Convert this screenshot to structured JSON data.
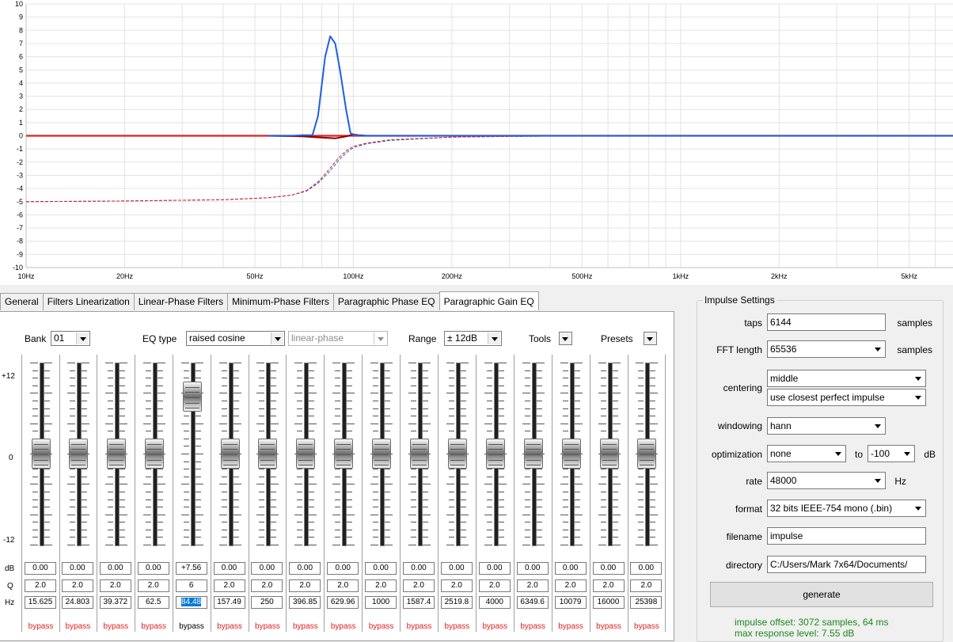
{
  "chart_data": {
    "type": "line",
    "xscale": "log",
    "xlim": [
      10,
      6800
    ],
    "ylim": [
      -10,
      10
    ],
    "y_ticks": [
      "10",
      "9",
      "8",
      "7",
      "6",
      "5",
      "4",
      "3",
      "2",
      "1",
      "0",
      "-1",
      "-2",
      "-3",
      "-4",
      "-5",
      "-6",
      "-7",
      "-8",
      "-9",
      "-10"
    ],
    "x_ticks": [
      {
        "label": "10Hz",
        "value": 10
      },
      {
        "label": "20Hz",
        "value": 20
      },
      {
        "label": "50Hz",
        "value": 50
      },
      {
        "label": "100Hz",
        "value": 100
      },
      {
        "label": "200Hz",
        "value": 200
      },
      {
        "label": "500Hz",
        "value": 500
      },
      {
        "label": "1kHz",
        "value": 1000
      },
      {
        "label": "2kHz",
        "value": 2000
      },
      {
        "label": "5kHz",
        "value": 5000
      }
    ],
    "grid": true,
    "series": [
      {
        "color": "#1f5fe0",
        "style": "solid",
        "x": [
          55,
          66,
          70,
          75,
          78,
          80,
          82,
          85,
          88,
          91,
          95,
          98,
          100,
          103,
          106,
          110,
          150,
          6800
        ],
        "y": [
          0,
          0,
          0.05,
          0.05,
          1.5,
          3.8,
          6.0,
          7.55,
          7.0,
          5.0,
          2.0,
          0.2,
          0.1,
          0.05,
          0,
          0,
          0,
          0
        ]
      },
      {
        "color": "#8b0000",
        "style": "solid",
        "x": [
          55,
          70,
          76,
          82,
          88,
          95,
          100,
          104,
          110,
          150,
          600
        ],
        "y": [
          0,
          -0.05,
          -0.1,
          -0.15,
          -0.2,
          -0.05,
          0.1,
          0.05,
          0,
          0,
          0
        ]
      },
      {
        "color": "#e02020",
        "style": "solid",
        "x": [
          10,
          6800
        ],
        "y": [
          0,
          0
        ]
      },
      {
        "color": "#1f5fe0",
        "style": "dashed",
        "x": [
          10,
          20,
          40,
          55,
          65,
          72,
          78,
          84,
          90,
          95,
          100,
          110,
          130,
          200,
          300,
          600
        ],
        "y": [
          -5,
          -4.95,
          -4.85,
          -4.7,
          -4.5,
          -4.2,
          -3.6,
          -2.8,
          -1.9,
          -1.3,
          -0.9,
          -0.6,
          -0.35,
          -0.1,
          -0.05,
          0
        ]
      },
      {
        "color": "#e02020",
        "style": "dashed",
        "x": [
          10,
          20,
          40,
          55,
          65,
          72,
          78,
          84,
          90,
          95,
          100,
          110,
          130,
          200,
          300,
          600
        ],
        "y": [
          -5,
          -4.95,
          -4.85,
          -4.7,
          -4.5,
          -4.15,
          -3.5,
          -2.6,
          -1.7,
          -1.15,
          -0.8,
          -0.55,
          -0.3,
          -0.1,
          -0.05,
          0
        ]
      }
    ]
  },
  "tabs": [
    {
      "label": "General",
      "active": false
    },
    {
      "label": "Filters Linearization",
      "active": false
    },
    {
      "label": "Linear-Phase Filters",
      "active": false
    },
    {
      "label": "Minimum-Phase Filters",
      "active": false
    },
    {
      "label": "Paragraphic Phase EQ",
      "active": false
    },
    {
      "label": "Paragraphic Gain EQ",
      "active": true
    }
  ],
  "controls": {
    "bank_label": "Bank",
    "bank_value": "01",
    "eqtype_label": "EQ type",
    "eqtype_value": "raised cosine",
    "phase_value": "linear-phase",
    "range_label": "Range",
    "range_value": "± 12dB",
    "tools_label": "Tools",
    "presets_label": "Presets"
  },
  "scale": {
    "top": "+12",
    "mid": "0",
    "bottom": "-12"
  },
  "rows": {
    "db": "dB",
    "q": "Q",
    "hz": "Hz"
  },
  "bands": [
    {
      "db": "0.00",
      "q": "2.0",
      "hz": "15.625",
      "gain": 0,
      "bypass": "bypass",
      "active": false
    },
    {
      "db": "0.00",
      "q": "2.0",
      "hz": "24.803",
      "gain": 0,
      "bypass": "bypass",
      "active": false
    },
    {
      "db": "0.00",
      "q": "2.0",
      "hz": "39.372",
      "gain": 0,
      "bypass": "bypass",
      "active": false
    },
    {
      "db": "0.00",
      "q": "2.0",
      "hz": "62.5",
      "gain": 0,
      "bypass": "bypass",
      "active": false
    },
    {
      "db": "+7.56",
      "q": "6",
      "hz": "84.48",
      "gain": 7.56,
      "bypass": "bypass",
      "active": true,
      "selected": true
    },
    {
      "db": "0.00",
      "q": "2.0",
      "hz": "157.49",
      "gain": 0,
      "bypass": "bypass",
      "active": false
    },
    {
      "db": "0.00",
      "q": "2.0",
      "hz": "250",
      "gain": 0,
      "bypass": "bypass",
      "active": false
    },
    {
      "db": "0.00",
      "q": "2.0",
      "hz": "396.85",
      "gain": 0,
      "bypass": "bypass",
      "active": false
    },
    {
      "db": "0.00",
      "q": "2.0",
      "hz": "629.96",
      "gain": 0,
      "bypass": "bypass",
      "active": false
    },
    {
      "db": "0.00",
      "q": "2.0",
      "hz": "1000",
      "gain": 0,
      "bypass": "bypass",
      "active": false
    },
    {
      "db": "0.00",
      "q": "2.0",
      "hz": "1587.4",
      "gain": 0,
      "bypass": "bypass",
      "active": false
    },
    {
      "db": "0.00",
      "q": "2.0",
      "hz": "2519.8",
      "gain": 0,
      "bypass": "bypass",
      "active": false
    },
    {
      "db": "0.00",
      "q": "2.0",
      "hz": "4000",
      "gain": 0,
      "bypass": "bypass",
      "active": false
    },
    {
      "db": "0.00",
      "q": "2.0",
      "hz": "6349.6",
      "gain": 0,
      "bypass": "bypass",
      "active": false
    },
    {
      "db": "0.00",
      "q": "2.0",
      "hz": "10079",
      "gain": 0,
      "bypass": "bypass",
      "active": false
    },
    {
      "db": "0.00",
      "q": "2.0",
      "hz": "16000",
      "gain": 0,
      "bypass": "bypass",
      "active": false
    },
    {
      "db": "0.00",
      "q": "2.0",
      "hz": "25398",
      "gain": 0,
      "bypass": "bypass",
      "active": false
    }
  ],
  "impulse": {
    "title": "Impulse Settings",
    "taps_label": "taps",
    "taps_value": "6144",
    "taps_unit": "samples",
    "fft_label": "FFT length",
    "fft_value": "65536",
    "fft_unit": "samples",
    "centering_label": "centering",
    "centering_value": "middle",
    "centering_mode": "use closest perfect impulse",
    "windowing_label": "windowing",
    "windowing_value": "hann",
    "optimization_label": "optimization",
    "optimization_value": "none",
    "optimization_to": "to",
    "optimization_db": "-100",
    "optimization_unit": "dB",
    "rate_label": "rate",
    "rate_value": "48000",
    "rate_unit": "Hz",
    "format_label": "format",
    "format_value": "32 bits IEEE-754 mono (.bin)",
    "filename_label": "filename",
    "filename_value": "impulse",
    "directory_label": "directory",
    "directory_value": "C:/Users/Mark 7x64/Documents/",
    "generate_label": "generate",
    "status_line1": "impulse offset: 3072 samples, 64 ms",
    "status_line2": "max response level: 7.55 dB"
  },
  "colors": {
    "accent_blue": "#1f5fe0",
    "red": "#e02020",
    "dark_red": "#8b0000",
    "status_green": "#1a8a1a"
  }
}
